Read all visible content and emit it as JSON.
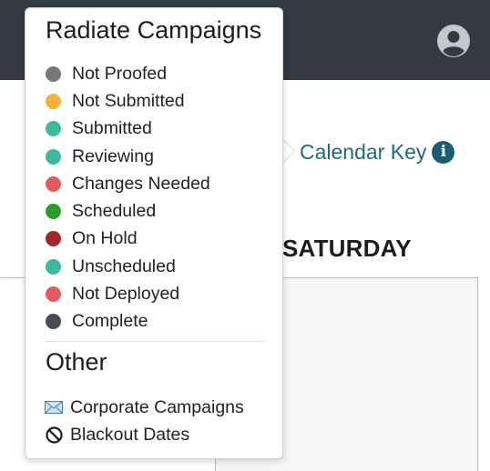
{
  "header": {
    "user_icon": "user-circle-icon"
  },
  "calendar_key": {
    "label": "Calendar Key",
    "info_icon": "i",
    "link_color": "#1f6a7a"
  },
  "calendar": {
    "day_header": "SATURDAY"
  },
  "popover": {
    "title": "Radiate Campaigns",
    "statuses": [
      {
        "label": "Not Proofed",
        "color": "#75787b"
      },
      {
        "label": "Not Submitted",
        "color": "#f5b041"
      },
      {
        "label": "Submitted",
        "color": "#3fb8a0"
      },
      {
        "label": "Reviewing",
        "color": "#3fb8a0"
      },
      {
        "label": "Changes Needed",
        "color": "#e35b62"
      },
      {
        "label": "Scheduled",
        "color": "#2a9d2a"
      },
      {
        "label": "On Hold",
        "color": "#a3262e"
      },
      {
        "label": "Unscheduled",
        "color": "#3fb8a0"
      },
      {
        "label": "Not Deployed",
        "color": "#e35b62"
      },
      {
        "label": "Complete",
        "color": "#474c54"
      }
    ],
    "other_title": "Other",
    "other_items": [
      {
        "label": "Corporate Campaigns",
        "icon": "envelope-icon"
      },
      {
        "label": "Blackout Dates",
        "icon": "no-entry-icon"
      }
    ]
  }
}
